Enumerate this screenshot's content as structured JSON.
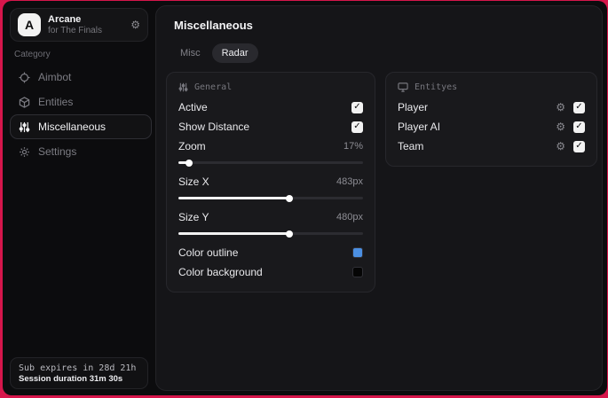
{
  "app": {
    "name": "Arcane",
    "subtitle": "for The Finals",
    "logo_letter": "A"
  },
  "sidebar": {
    "category_label": "Category",
    "items": [
      {
        "label": "Aimbot",
        "icon": "crosshair-icon",
        "selected": false
      },
      {
        "label": "Entities",
        "icon": "cube-icon",
        "selected": false
      },
      {
        "label": "Miscellaneous",
        "icon": "sliders-icon",
        "selected": true
      },
      {
        "label": "Settings",
        "icon": "gear-icon",
        "selected": false
      }
    ],
    "footer": {
      "sub_expires": "Sub expires in 28d 21h",
      "session_duration": "Session duration 31m 30s"
    }
  },
  "main": {
    "title": "Miscellaneous",
    "tabs": [
      {
        "label": "Misc",
        "active": false
      },
      {
        "label": "Radar",
        "active": true
      }
    ],
    "general_card": {
      "title": "General",
      "rows": [
        {
          "label": "Active",
          "type": "checkbox",
          "checked": true
        },
        {
          "label": "Show Distance",
          "type": "checkbox",
          "checked": true
        },
        {
          "label": "Zoom",
          "type": "slider",
          "value": "17%",
          "percent": 6
        },
        {
          "label": "Size X",
          "type": "slider",
          "value": "483px",
          "percent": 60
        },
        {
          "label": "Size Y",
          "type": "slider",
          "value": "480px",
          "percent": 60
        },
        {
          "label": "Color outline",
          "type": "color",
          "color": "#4b8fe2"
        },
        {
          "label": "Color background",
          "type": "color",
          "color": "#050505"
        }
      ]
    },
    "entities_card": {
      "title": "Entityes",
      "rows": [
        {
          "label": "Player",
          "checked": true
        },
        {
          "label": "Player AI",
          "checked": true
        },
        {
          "label": "Team",
          "checked": true
        }
      ]
    }
  },
  "glyphs": {
    "check": "✓",
    "gear": "⚙"
  },
  "colors": {
    "backdrop_red": "#d6164b",
    "outline_swatch": "#4b8fe2",
    "background_swatch": "#050505"
  }
}
